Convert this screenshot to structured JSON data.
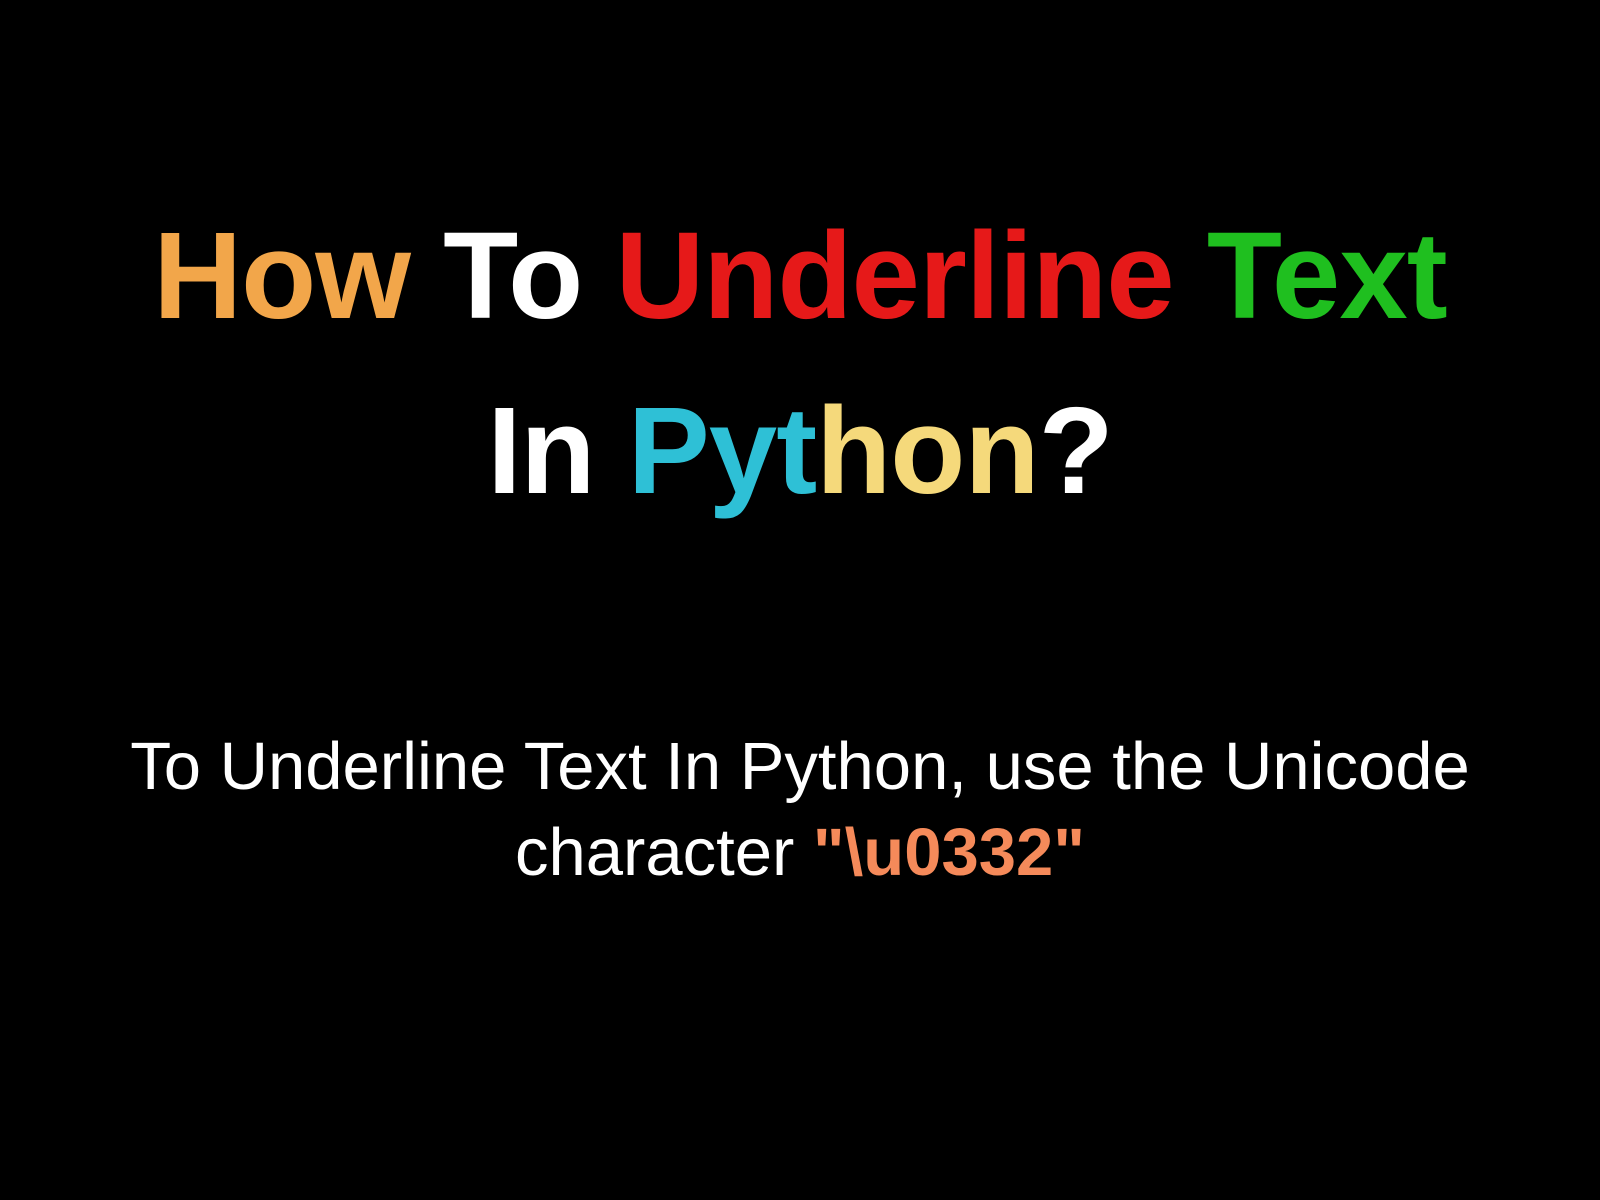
{
  "title": {
    "words": [
      {
        "text": "How",
        "color": "orange"
      },
      {
        "text": "To",
        "color": "white"
      },
      {
        "text": "Underline",
        "color": "red"
      },
      {
        "text": "Text",
        "color": "green"
      }
    ],
    "line2_in": {
      "text": "In",
      "color": "white"
    },
    "python_parts": [
      {
        "text": "Pyt",
        "color": "cyan"
      },
      {
        "text": "hon",
        "color": "yellow"
      }
    ],
    "qmark": {
      "text": "?",
      "color": "white"
    }
  },
  "subtitle": {
    "plain": "To Underline Text In Python, use the Unicode character ",
    "code": "\"\\u0332\""
  }
}
